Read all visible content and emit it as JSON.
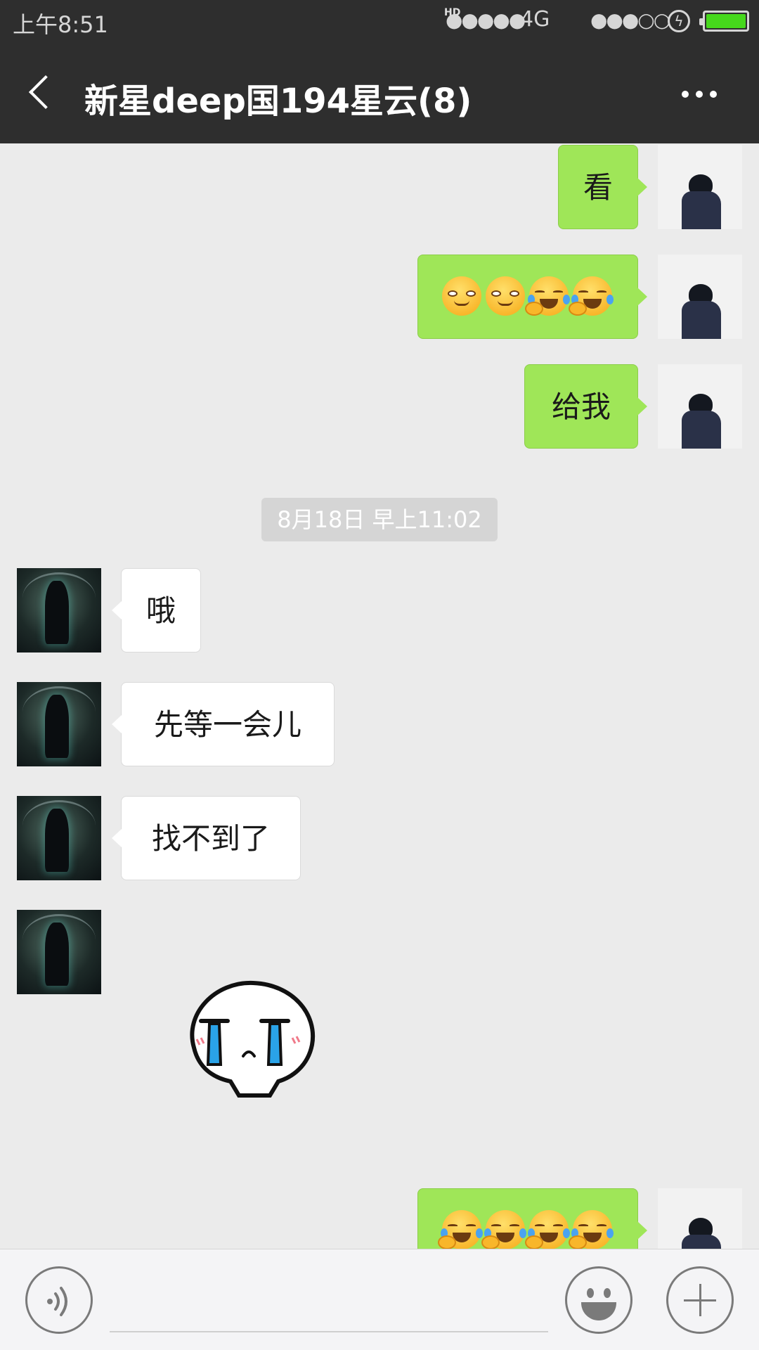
{
  "status_bar": {
    "time": "上午8:51",
    "hd": "HD",
    "signal_1": "●●●●●",
    "network": "4G",
    "signal_2": "●●●○○",
    "charging": "ϟ",
    "battery_level": 1.0
  },
  "header": {
    "back_icon": "chevron-left-icon",
    "title": "新星deep国194星云(8)",
    "more_icon": "more-dots-icon"
  },
  "messages": [
    {
      "from": "me",
      "type": "text",
      "text": "看"
    },
    {
      "from": "me",
      "type": "emoji",
      "emojis": [
        "smirk",
        "smirk",
        "laugh-cry",
        "laugh-cry"
      ]
    },
    {
      "from": "me",
      "type": "text",
      "text": "给我"
    },
    {
      "type": "timestamp",
      "text": "8月18日 早上11:02"
    },
    {
      "from": "them",
      "type": "text",
      "text": "哦"
    },
    {
      "from": "them",
      "type": "text",
      "text": "先等一会儿"
    },
    {
      "from": "them",
      "type": "text",
      "text": "找不到了"
    },
    {
      "from": "them",
      "type": "sticker",
      "sticker": "crying-face-sticker"
    },
    {
      "from": "me",
      "type": "emoji",
      "emojis": [
        "laugh-cry",
        "laugh-cry",
        "laugh-cry",
        "laugh-cry"
      ]
    }
  ],
  "input_bar": {
    "voice_icon": "voice-icon",
    "input_placeholder": "",
    "emoji_icon": "emoji-icon",
    "plus_icon": "plus-icon"
  }
}
